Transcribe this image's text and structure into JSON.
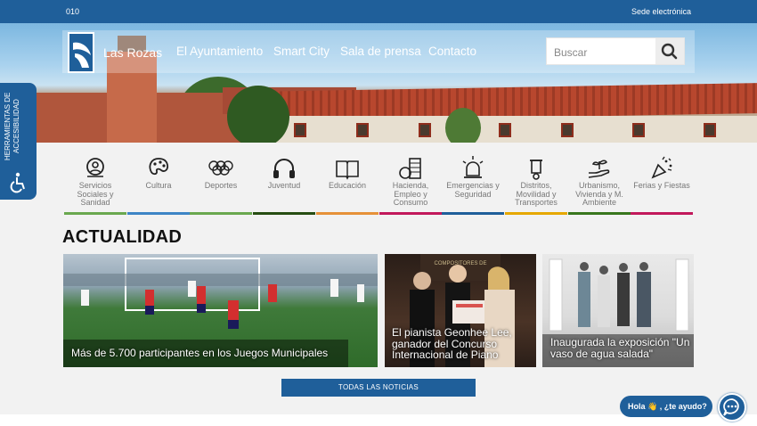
{
  "topbar": {
    "left": "010",
    "right": "Sede electrónica"
  },
  "header": {
    "brand": "Las Rozas",
    "menu": [
      "El Ayuntamiento",
      "Smart City",
      "Sala de prensa",
      "Contacto"
    ],
    "search_placeholder": "Buscar"
  },
  "accessibility": {
    "label": "HERRAMIENTAS DE ACCESIBILIDAD"
  },
  "categories": [
    {
      "label": "Servicios Sociales y Sanidad",
      "icon": "social-services-icon",
      "color": "#6aa84f"
    },
    {
      "label": "Cultura",
      "icon": "palette-icon",
      "color": "#3d85c6"
    },
    {
      "label": "Deportes",
      "icon": "olympic-rings-icon",
      "color": "#6aa84f"
    },
    {
      "label": "Juventud",
      "icon": "headphones-icon",
      "color": "#274e13"
    },
    {
      "label": "Educación",
      "icon": "book-icon",
      "color": "#e69138"
    },
    {
      "label": "Hacienda, Empleo y Consumo",
      "icon": "coins-icon",
      "color": "#c2185b"
    },
    {
      "label": "Emergencias y Seguridad",
      "icon": "siren-icon",
      "color": "#1f5f9a"
    },
    {
      "label": "Distritos, Movilidad y Transportes",
      "icon": "scooter-icon",
      "color": "#e6a800"
    },
    {
      "label": "Urbanismo, Vivienda y M. Ambiente",
      "icon": "plant-hand-icon",
      "color": "#38761d"
    },
    {
      "label": "Ferias y Fiestas",
      "icon": "party-popper-icon",
      "color": "#c2185b"
    }
  ],
  "news": {
    "title": "ACTUALIDAD",
    "items": [
      "Más de 5.700 participantes en los Juegos Municipales",
      "El pianista Geonhee Lee, ganador del Concurso Internacional de Piano",
      "Inaugurada la exposición \"Un vaso de agua salada\""
    ],
    "all_button": "TODAS LAS NOTICIAS",
    "banner_text": "COMPOSITORES DE"
  },
  "chat": {
    "label": "Hola 👋 , ¿te ayudo?"
  },
  "colors": {
    "primary": "#1f5f9a"
  }
}
